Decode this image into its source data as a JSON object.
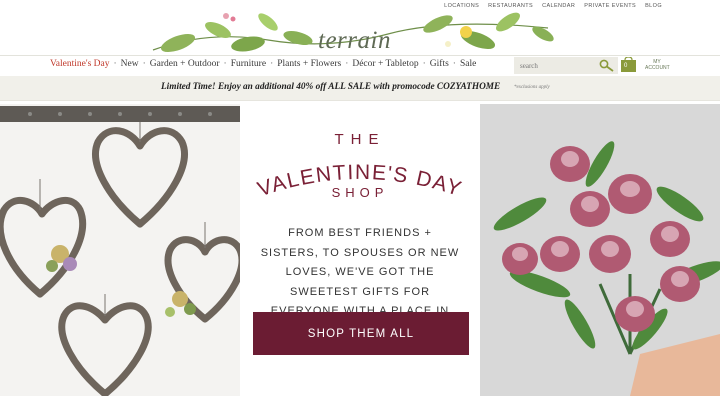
{
  "utility_links": [
    "LOCATIONS",
    "RESTAURANTS",
    "CALENDAR",
    "PRIVATE EVENTS",
    "BLOG"
  ],
  "brand": {
    "logo": "terrain"
  },
  "nav": {
    "items": [
      "Valentine's Day",
      "New",
      "Garden + Outdoor",
      "Furniture",
      "Plants + Flowers",
      "Décor + Tabletop",
      "Gifts",
      "Sale"
    ],
    "separator": "·",
    "active_color": "#c0392b"
  },
  "search": {
    "placeholder": "search",
    "icon": "key-search-icon"
  },
  "cart": {
    "count": "0",
    "icon": "cart-icon"
  },
  "account": {
    "line1": "MY",
    "line2": "ACCOUNT"
  },
  "promo": {
    "text": "Limited Time! Enjoy an additional 40% off ALL SALE with promocode COZYATHOME",
    "note": "*exclusions apply"
  },
  "hero": {
    "the": "THE",
    "headline": "VALENTINE'S DAY",
    "shop": "SHOP",
    "description": "FROM BEST FRIENDS + SISTERS, TO SPOUSES OR NEW LOVES, WE'VE GOT THE SWEETEST GIFTS FOR EVERYONE WITH A PLACE IN YOUR HEART.",
    "cta": "SHOP THEM ALL",
    "accent_color": "#7a2036",
    "button_color": "#6b1c33"
  }
}
